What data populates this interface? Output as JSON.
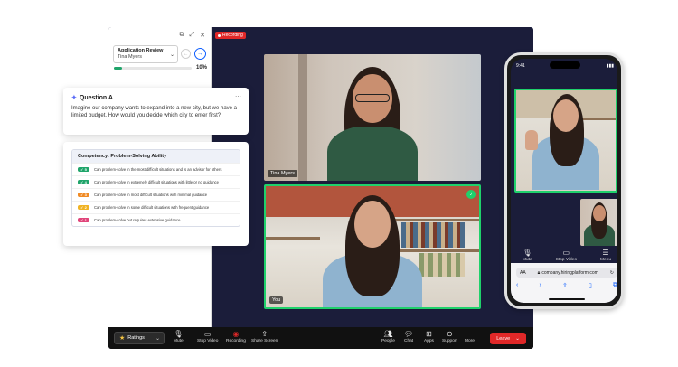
{
  "meeting": {
    "recording_badge": "Recording",
    "side_panel": {
      "app_title": "Application Review",
      "candidate": "Tina Myers",
      "progress_pct": 10,
      "progress_label": "10%"
    },
    "participants": [
      {
        "name": "Tina Myers"
      },
      {
        "name": "You"
      }
    ],
    "toolbar": {
      "ratings_label": "Ratings",
      "items": [
        {
          "label": "Mute",
          "icon": "microphone-icon"
        },
        {
          "label": "Stop Video",
          "icon": "video-camera-icon"
        },
        {
          "label": "Recording",
          "icon": "record-icon"
        },
        {
          "label": "Share Screen",
          "icon": "share-screen-icon"
        },
        {
          "label": "People",
          "icon": "people-icon"
        },
        {
          "label": "Chat",
          "icon": "chat-icon"
        },
        {
          "label": "Apps",
          "icon": "apps-icon"
        },
        {
          "label": "Support",
          "icon": "support-icon"
        },
        {
          "label": "More",
          "icon": "more-icon"
        }
      ],
      "leave_label": "Leave"
    }
  },
  "question_card": {
    "title": "Question A",
    "text": "Imagine our company wants to expand into a new city, but we have a limited budget. How would you decide which city to enter first?"
  },
  "competency_card": {
    "title": "Competency: Problem-Solving Ability",
    "rows": [
      {
        "score": "5",
        "color": "#1fa46a",
        "text": "Can problem-solve in the most difficult situations and is an advisor for others"
      },
      {
        "score": "4",
        "color": "#1fa46a",
        "text": "Can problem-solve in extremely difficult situations with little or no guidance"
      },
      {
        "score": "3",
        "color": "#f08a24",
        "text": "Can problem-solve in most difficult situations with minimal guidance"
      },
      {
        "score": "2",
        "color": "#f0b324",
        "text": "Can problem-solve in some difficult situations with frequent guidance"
      },
      {
        "score": "1",
        "color": "#e0457a",
        "text": "Can problem-solve but requires extensive guidance"
      }
    ]
  },
  "phone": {
    "time": "9:41",
    "controls": [
      {
        "label": "Mute",
        "icon": "microphone-icon"
      },
      {
        "label": "Stop Video",
        "icon": "video-camera-icon"
      },
      {
        "label": "Menu",
        "icon": "menu-icon"
      }
    ],
    "url": "company.hiringplatform.com",
    "url_prefix": "AA"
  }
}
